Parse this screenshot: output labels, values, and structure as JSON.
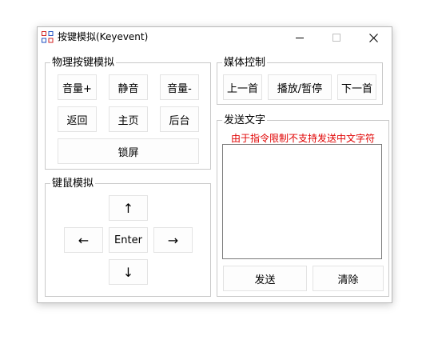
{
  "window": {
    "title": "按键模拟(Keyevent)",
    "controls": {
      "minimize": "minimize-icon",
      "maximize": "maximize-icon",
      "close": "close-icon"
    }
  },
  "physical": {
    "title": "物理按键模拟",
    "vol_up": "音量+",
    "mute": "静音",
    "vol_down": "音量-",
    "back": "返回",
    "home": "主页",
    "recent": "后台",
    "lock": "锁屏"
  },
  "media": {
    "title": "媒体控制",
    "prev": "上一首",
    "play_pause": "播放/暂停",
    "next": "下一首"
  },
  "keymouse": {
    "title": "键鼠模拟",
    "up": "↑",
    "left": "←",
    "enter": "Enter",
    "right": "→",
    "down": "↓"
  },
  "send_text": {
    "title": "发送文字",
    "hint": "由于指令限制不支持发送中文字符",
    "hint_color": "#e00000",
    "input_value": "",
    "send": "发送",
    "clear": "清除"
  }
}
